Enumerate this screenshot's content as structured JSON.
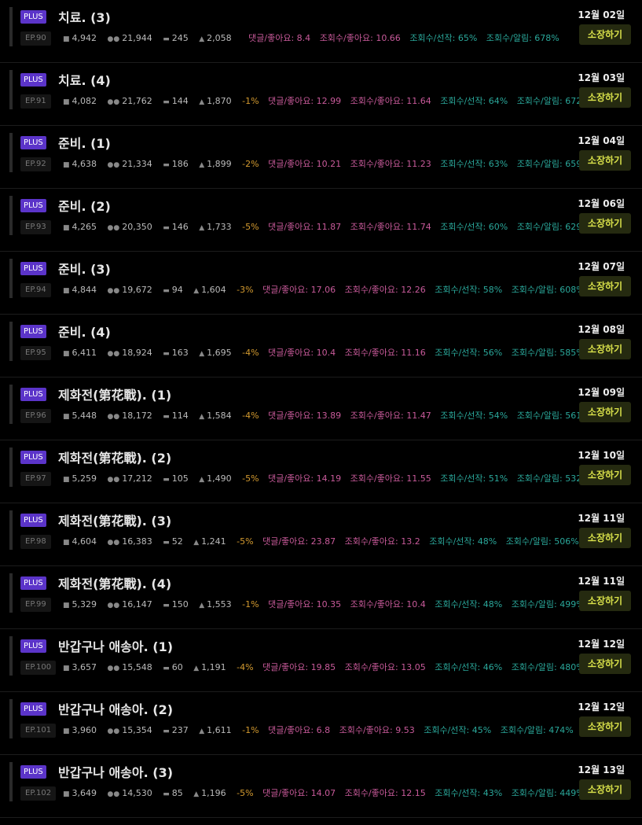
{
  "episodes": [
    {
      "badge": "PLUS",
      "title": "치료. (3)",
      "ep": "EP.90",
      "words": "4,942",
      "views": "21,944",
      "comments": "245",
      "likes": "2,058",
      "pct": "",
      "m1": "댓글/좋아요: 8.4",
      "m2": "조회수/좋아요: 10.66",
      "m3": "조회수/선작: 65%",
      "m4": "조회수/알림: 678%",
      "date": "12월 02일",
      "button": "소장하기"
    },
    {
      "badge": "PLUS",
      "title": "치료. (4)",
      "ep": "EP.91",
      "words": "4,082",
      "views": "21,762",
      "comments": "144",
      "likes": "1,870",
      "pct": "-1%",
      "m1": "댓글/좋아요: 12.99",
      "m2": "조회수/좋아요: 11.64",
      "m3": "조회수/선작: 64%",
      "m4": "조회수/알림: 672%",
      "date": "12월 03일",
      "button": "소장하기"
    },
    {
      "badge": "PLUS",
      "title": "준비. (1)",
      "ep": "EP.92",
      "words": "4,638",
      "views": "21,334",
      "comments": "186",
      "likes": "1,899",
      "pct": "-2%",
      "m1": "댓글/좋아요: 10.21",
      "m2": "조회수/좋아요: 11.23",
      "m3": "조회수/선작: 63%",
      "m4": "조회수/알림: 659%",
      "date": "12월 04일",
      "button": "소장하기"
    },
    {
      "badge": "PLUS",
      "title": "준비. (2)",
      "ep": "EP.93",
      "words": "4,265",
      "views": "20,350",
      "comments": "146",
      "likes": "1,733",
      "pct": "-5%",
      "m1": "댓글/좋아요: 11.87",
      "m2": "조회수/좋아요: 11.74",
      "m3": "조회수/선작: 60%",
      "m4": "조회수/알림: 629%",
      "date": "12월 06일",
      "button": "소장하기"
    },
    {
      "badge": "PLUS",
      "title": "준비. (3)",
      "ep": "EP.94",
      "words": "4,844",
      "views": "19,672",
      "comments": "94",
      "likes": "1,604",
      "pct": "-3%",
      "m1": "댓글/좋아요: 17.06",
      "m2": "조회수/좋아요: 12.26",
      "m3": "조회수/선작: 58%",
      "m4": "조회수/알림: 608%",
      "date": "12월 07일",
      "button": "소장하기"
    },
    {
      "badge": "PLUS",
      "title": "준비. (4)",
      "ep": "EP.95",
      "words": "6,411",
      "views": "18,924",
      "comments": "163",
      "likes": "1,695",
      "pct": "-4%",
      "m1": "댓글/좋아요: 10.4",
      "m2": "조회수/좋아요: 11.16",
      "m3": "조회수/선작: 56%",
      "m4": "조회수/알림: 585%",
      "date": "12월 08일",
      "button": "소장하기"
    },
    {
      "badge": "PLUS",
      "title": "제화전(第花戰). (1)",
      "ep": "EP.96",
      "words": "5,448",
      "views": "18,172",
      "comments": "114",
      "likes": "1,584",
      "pct": "-4%",
      "m1": "댓글/좋아요: 13.89",
      "m2": "조회수/좋아요: 11.47",
      "m3": "조회수/선작: 54%",
      "m4": "조회수/알림: 561%",
      "date": "12월 09일",
      "button": "소장하기"
    },
    {
      "badge": "PLUS",
      "title": "제화전(第花戰). (2)",
      "ep": "EP.97",
      "words": "5,259",
      "views": "17,212",
      "comments": "105",
      "likes": "1,490",
      "pct": "-5%",
      "m1": "댓글/좋아요: 14.19",
      "m2": "조회수/좋아요: 11.55",
      "m3": "조회수/선작: 51%",
      "m4": "조회수/알림: 532%",
      "date": "12월 10일",
      "button": "소장하기"
    },
    {
      "badge": "PLUS",
      "title": "제화전(第花戰). (3)",
      "ep": "EP.98",
      "words": "4,604",
      "views": "16,383",
      "comments": "52",
      "likes": "1,241",
      "pct": "-5%",
      "m1": "댓글/좋아요: 23.87",
      "m2": "조회수/좋아요: 13.2",
      "m3": "조회수/선작: 48%",
      "m4": "조회수/알림: 506%",
      "date": "12월 11일",
      "button": "소장하기"
    },
    {
      "badge": "PLUS",
      "title": "제화전(第花戰). (4)",
      "ep": "EP.99",
      "words": "5,329",
      "views": "16,147",
      "comments": "150",
      "likes": "1,553",
      "pct": "-1%",
      "m1": "댓글/좋아요: 10.35",
      "m2": "조회수/좋아요: 10.4",
      "m3": "조회수/선작: 48%",
      "m4": "조회수/알림: 499%",
      "date": "12월 11일",
      "button": "소장하기"
    },
    {
      "badge": "PLUS",
      "title": "반갑구나 애송아. (1)",
      "ep": "EP.100",
      "words": "3,657",
      "views": "15,548",
      "comments": "60",
      "likes": "1,191",
      "pct": "-4%",
      "m1": "댓글/좋아요: 19.85",
      "m2": "조회수/좋아요: 13.05",
      "m3": "조회수/선작: 46%",
      "m4": "조회수/알림: 480%",
      "date": "12월 12일",
      "button": "소장하기"
    },
    {
      "badge": "PLUS",
      "title": "반갑구나 애송아. (2)",
      "ep": "EP.101",
      "words": "3,960",
      "views": "15,354",
      "comments": "237",
      "likes": "1,611",
      "pct": "-1%",
      "m1": "댓글/좋아요: 6.8",
      "m2": "조회수/좋아요: 9.53",
      "m3": "조회수/선작: 45%",
      "m4": "조회수/알림: 474%",
      "date": "12월 12일",
      "button": "소장하기"
    },
    {
      "badge": "PLUS",
      "title": "반갑구나 애송아. (3)",
      "ep": "EP.102",
      "words": "3,649",
      "views": "14,530",
      "comments": "85",
      "likes": "1,196",
      "pct": "-5%",
      "m1": "댓글/좋아요: 14.07",
      "m2": "조회수/좋아요: 12.15",
      "m3": "조회수/선작: 43%",
      "m4": "조회수/알림: 449%",
      "date": "12월 13일",
      "button": "소장하기"
    }
  ]
}
